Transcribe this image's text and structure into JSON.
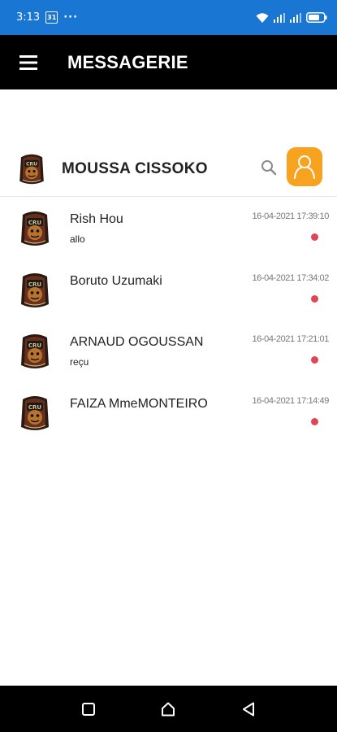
{
  "status_bar": {
    "time": "3:13",
    "calendar_badge": "31",
    "more_dots": "···",
    "icons": [
      "wifi-icon",
      "signal-icon",
      "signal-icon",
      "battery-icon"
    ]
  },
  "app_bar": {
    "title": "MESSAGERIE",
    "menu_icon": "hamburger-icon"
  },
  "profile": {
    "name": "MOUSSA CISSOKO",
    "search_icon": "search-icon",
    "contacts_icon": "person-outline-icon",
    "accent_color": "#f7a31f"
  },
  "conversations": [
    {
      "name": "Rish Hou",
      "preview": "allo",
      "time": "16-04-2021 17:39:10",
      "unread": true
    },
    {
      "name": "Boruto Uzumaki",
      "preview": "",
      "time": "16-04-2021 17:34:02",
      "unread": true
    },
    {
      "name": "ARNAUD OGOUSSAN",
      "preview": "reçu",
      "time": "16-04-2021 17:21:01",
      "unread": true
    },
    {
      "name": "FAIZA MmeMONTEIRO",
      "preview": "",
      "time": "16-04-2021 17:14:49",
      "unread": true
    }
  ],
  "colors": {
    "status_bar": "#1976d2",
    "app_bar": "#000000",
    "unread_dot": "#e04455"
  },
  "nav_bar": {
    "icons": [
      "recents-square-icon",
      "home-icon",
      "back-triangle-icon"
    ]
  }
}
